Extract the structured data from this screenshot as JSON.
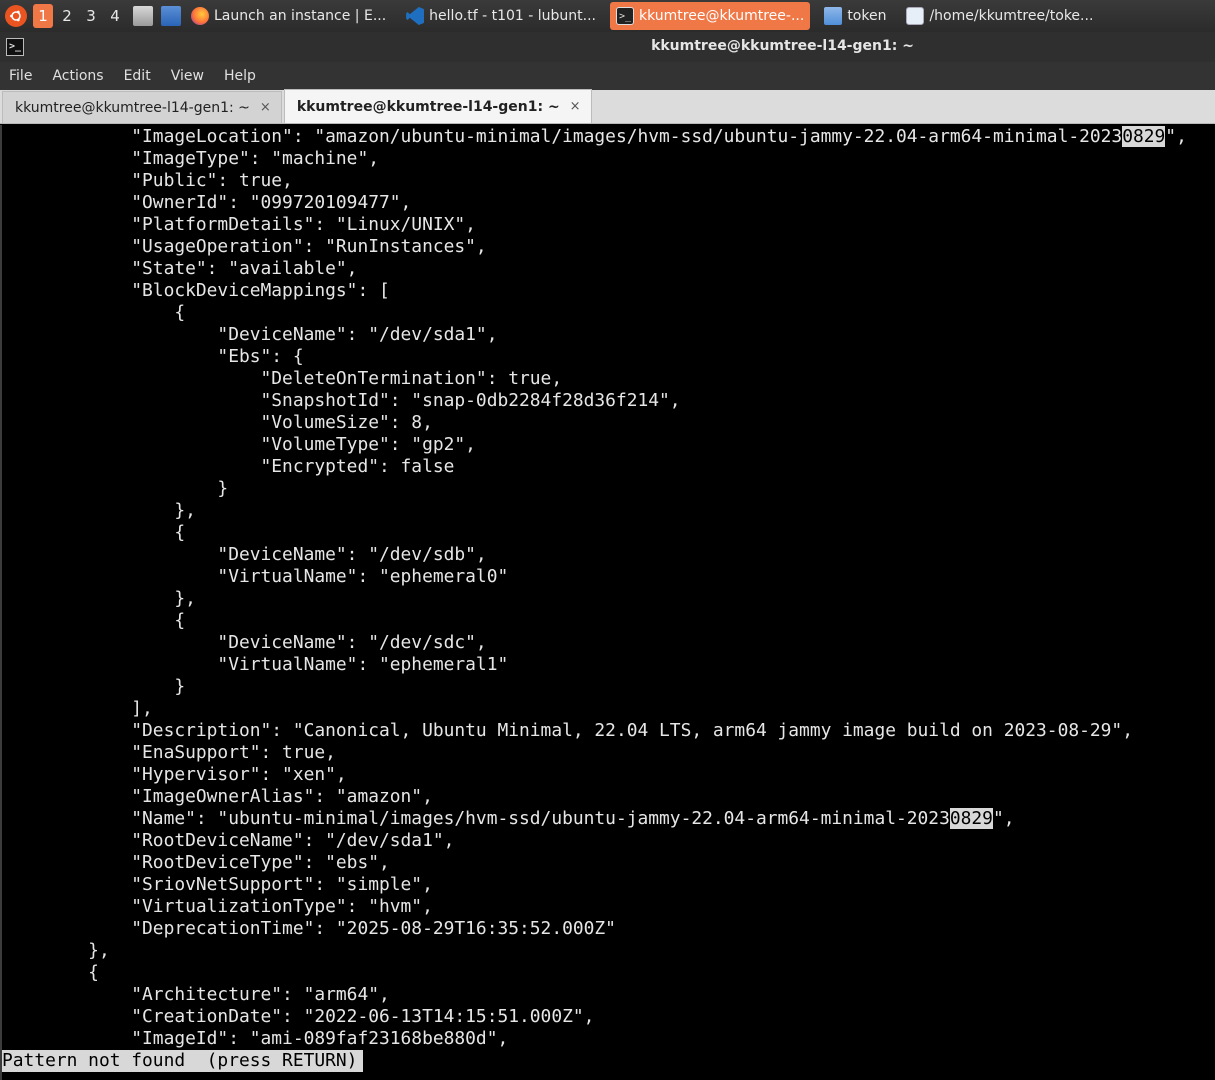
{
  "taskbar": {
    "workspaces": [
      "1",
      "2",
      "3",
      "4"
    ],
    "tasks": [
      {
        "label": "Launch an instance | E..."
      },
      {
        "label": "hello.tf - t101 - lubunt..."
      },
      {
        "label": "kkumtree@kkumtree-..."
      },
      {
        "label": "token"
      },
      {
        "label": "/home/kkumtree/toke..."
      }
    ]
  },
  "window": {
    "title": "kkumtree@kkumtree-l14-gen1: ~",
    "menu": [
      "File",
      "Actions",
      "Edit",
      "View",
      "Help"
    ],
    "tabs": [
      {
        "label": "kkumtree@kkumtree-l14-gen1: ~",
        "close": "×"
      },
      {
        "label": "kkumtree@kkumtree-l14-gen1: ~",
        "close": "×"
      }
    ]
  },
  "terminal": {
    "lines": [
      {
        "text": "            \"ImageLocation\": \"amazon/ubuntu-minimal/images/hvm-ssd/ubuntu-jammy-22.04-arm64-minimal-2023",
        "hl": "0829",
        "tail": "\","
      },
      {
        "text": "            \"ImageType\": \"machine\","
      },
      {
        "text": "            \"Public\": true,"
      },
      {
        "text": "            \"OwnerId\": \"099720109477\","
      },
      {
        "text": "            \"PlatformDetails\": \"Linux/UNIX\","
      },
      {
        "text": "            \"UsageOperation\": \"RunInstances\","
      },
      {
        "text": "            \"State\": \"available\","
      },
      {
        "text": "            \"BlockDeviceMappings\": ["
      },
      {
        "text": "                {"
      },
      {
        "text": "                    \"DeviceName\": \"/dev/sda1\","
      },
      {
        "text": "                    \"Ebs\": {"
      },
      {
        "text": "                        \"DeleteOnTermination\": true,"
      },
      {
        "text": "                        \"SnapshotId\": \"snap-0db2284f28d36f214\","
      },
      {
        "text": "                        \"VolumeSize\": 8,"
      },
      {
        "text": "                        \"VolumeType\": \"gp2\","
      },
      {
        "text": "                        \"Encrypted\": false"
      },
      {
        "text": "                    }"
      },
      {
        "text": "                },"
      },
      {
        "text": "                {"
      },
      {
        "text": "                    \"DeviceName\": \"/dev/sdb\","
      },
      {
        "text": "                    \"VirtualName\": \"ephemeral0\""
      },
      {
        "text": "                },"
      },
      {
        "text": "                {"
      },
      {
        "text": "                    \"DeviceName\": \"/dev/sdc\","
      },
      {
        "text": "                    \"VirtualName\": \"ephemeral1\""
      },
      {
        "text": "                }"
      },
      {
        "text": "            ],"
      },
      {
        "text": "            \"Description\": \"Canonical, Ubuntu Minimal, 22.04 LTS, arm64 jammy image build on 2023-08-29\","
      },
      {
        "text": "            \"EnaSupport\": true,"
      },
      {
        "text": "            \"Hypervisor\": \"xen\","
      },
      {
        "text": "            \"ImageOwnerAlias\": \"amazon\","
      },
      {
        "text": "            \"Name\": \"ubuntu-minimal/images/hvm-ssd/ubuntu-jammy-22.04-arm64-minimal-2023",
        "hl": "0829",
        "tail": "\","
      },
      {
        "text": "            \"RootDeviceName\": \"/dev/sda1\","
      },
      {
        "text": "            \"RootDeviceType\": \"ebs\","
      },
      {
        "text": "            \"SriovNetSupport\": \"simple\","
      },
      {
        "text": "            \"VirtualizationType\": \"hvm\","
      },
      {
        "text": "            \"DeprecationTime\": \"2025-08-29T16:35:52.000Z\""
      },
      {
        "text": "        },"
      },
      {
        "text": "        {"
      },
      {
        "text": "            \"Architecture\": \"arm64\","
      },
      {
        "text": "            \"CreationDate\": \"2022-06-13T14:15:51.000Z\","
      },
      {
        "text": "            \"ImageId\": \"ami-089faf23168be880d\","
      }
    ],
    "status": "Pattern not found  (press RETURN)"
  }
}
